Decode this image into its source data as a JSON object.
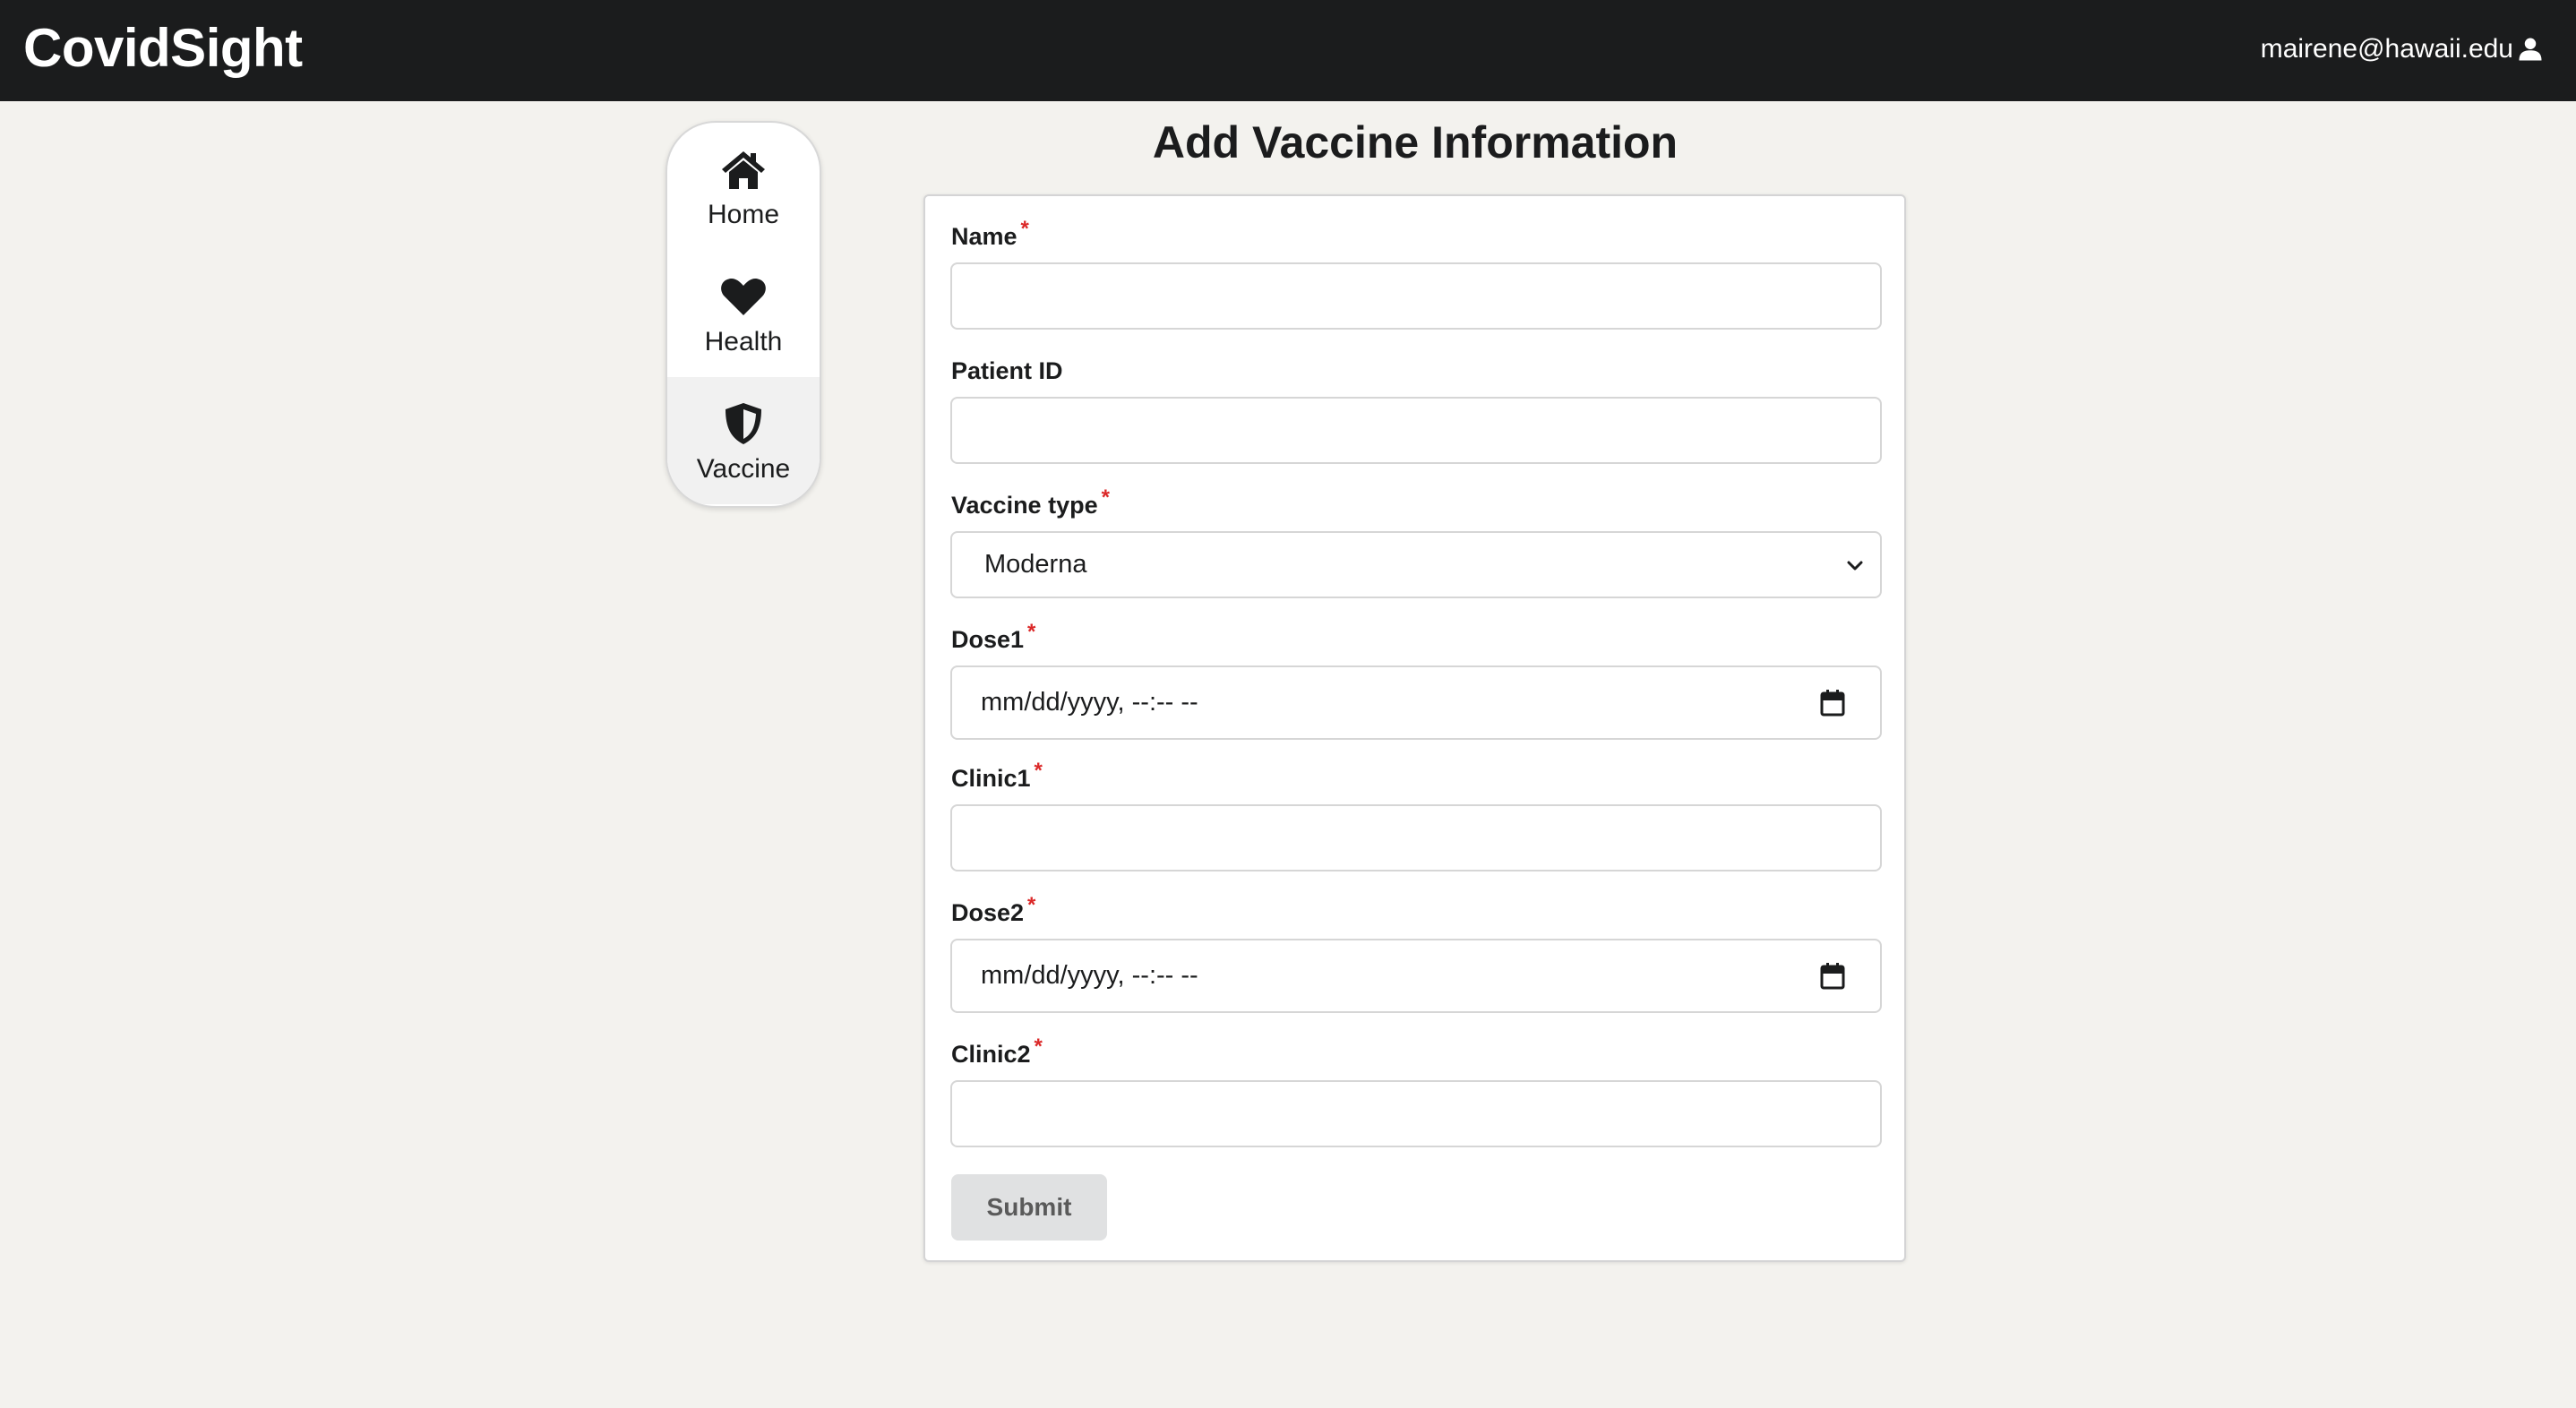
{
  "app": {
    "brand": "CovidSight",
    "user_email": "mairene@hawaii.edu"
  },
  "sidebar": {
    "items": [
      {
        "label": "Home",
        "icon": "home-icon",
        "active": false
      },
      {
        "label": "Health",
        "icon": "heart-icon",
        "active": false
      },
      {
        "label": "Vaccine",
        "icon": "shield-icon",
        "active": true
      }
    ]
  },
  "form": {
    "title": "Add Vaccine Information",
    "fields": {
      "name": {
        "label": "Name",
        "value": "",
        "required": true
      },
      "patient_id": {
        "label": "Patient ID",
        "value": "",
        "required": false
      },
      "vaccine_type": {
        "label": "Vaccine type",
        "value": "Moderna",
        "required": true
      },
      "dose1": {
        "label": "Dose1",
        "placeholder": "mm/dd/yyyy, --:-- --",
        "required": true
      },
      "clinic1": {
        "label": "Clinic1",
        "value": "",
        "required": true
      },
      "dose2": {
        "label": "Dose2",
        "placeholder": "mm/dd/yyyy, --:-- --",
        "required": true
      },
      "clinic2": {
        "label": "Clinic2",
        "value": "",
        "required": true
      }
    },
    "required_marker": "*",
    "submit_label": "Submit"
  },
  "colors": {
    "topbar": "#1b1c1d",
    "page_bg": "#f3f2ee",
    "required": "#db2828",
    "submit_bg": "#e0e1e2"
  }
}
